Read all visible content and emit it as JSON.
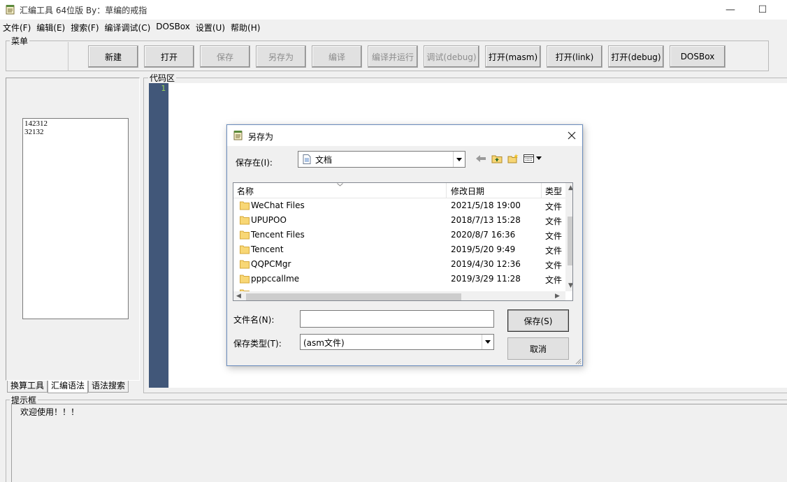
{
  "window": {
    "title": "汇编工具 64位版  By：草编的戒指",
    "icon": "notepad-icon",
    "minimize_glyph": "—",
    "maximize_glyph": "☐"
  },
  "menubar": [
    "文件(F)",
    "编辑(E)",
    "搜索(F)",
    "编译调试(C)",
    "DOSBox",
    "设置(U)",
    "帮助(H)"
  ],
  "toolbar": {
    "legend": "菜单",
    "buttons": [
      {
        "label": "新建",
        "enabled": true
      },
      {
        "label": "打开",
        "enabled": true
      },
      {
        "label": "保存",
        "enabled": false
      },
      {
        "label": "另存为",
        "enabled": false
      },
      {
        "label": "编译",
        "enabled": false
      },
      {
        "label": "编译并运行",
        "enabled": false
      },
      {
        "label": "调试(debug)",
        "enabled": false
      },
      {
        "label": "打开(masm)",
        "enabled": true
      },
      {
        "label": "打开(link)",
        "enabled": true
      },
      {
        "label": "打开(debug)",
        "enabled": true
      },
      {
        "label": "DOSBox",
        "enabled": true
      }
    ]
  },
  "left_panel": {
    "list_items": [
      "142312",
      "32132"
    ],
    "tabs": [
      "换算工具",
      "汇编语法",
      "语法搜索"
    ],
    "active_tab": 1
  },
  "code_area": {
    "legend": "代码区",
    "line_numbers": [
      "1"
    ],
    "gutter_color": "#415779",
    "line_number_color": "#9fdc58"
  },
  "hint_box": {
    "legend": "提示框",
    "message": "欢迎使用！！！"
  },
  "save_dialog": {
    "title": "另存为",
    "save_in_label": "保存在(I):",
    "save_in_value": "文档",
    "columns": {
      "name": "名称",
      "date": "修改日期",
      "type": "类型"
    },
    "files": [
      {
        "name": "WeChat Files",
        "date": "2021/5/18 19:00",
        "type": "文件"
      },
      {
        "name": "UPUPOO",
        "date": "2018/7/13 15:28",
        "type": "文件"
      },
      {
        "name": "Tencent Files",
        "date": "2020/8/7 16:36",
        "type": "文件"
      },
      {
        "name": "Tencent",
        "date": "2019/5/20 9:49",
        "type": "文件"
      },
      {
        "name": "QQPCMgr",
        "date": "2019/4/30 12:36",
        "type": "文件"
      },
      {
        "name": "pppccallme",
        "date": "2019/3/29 11:28",
        "type": "文件"
      }
    ],
    "filename_label": "文件名(N):",
    "filename_value": "",
    "filetype_label": "保存类型(T):",
    "filetype_value": "(asm文件)",
    "save_button": "保存(S)",
    "cancel_button": "取消"
  }
}
